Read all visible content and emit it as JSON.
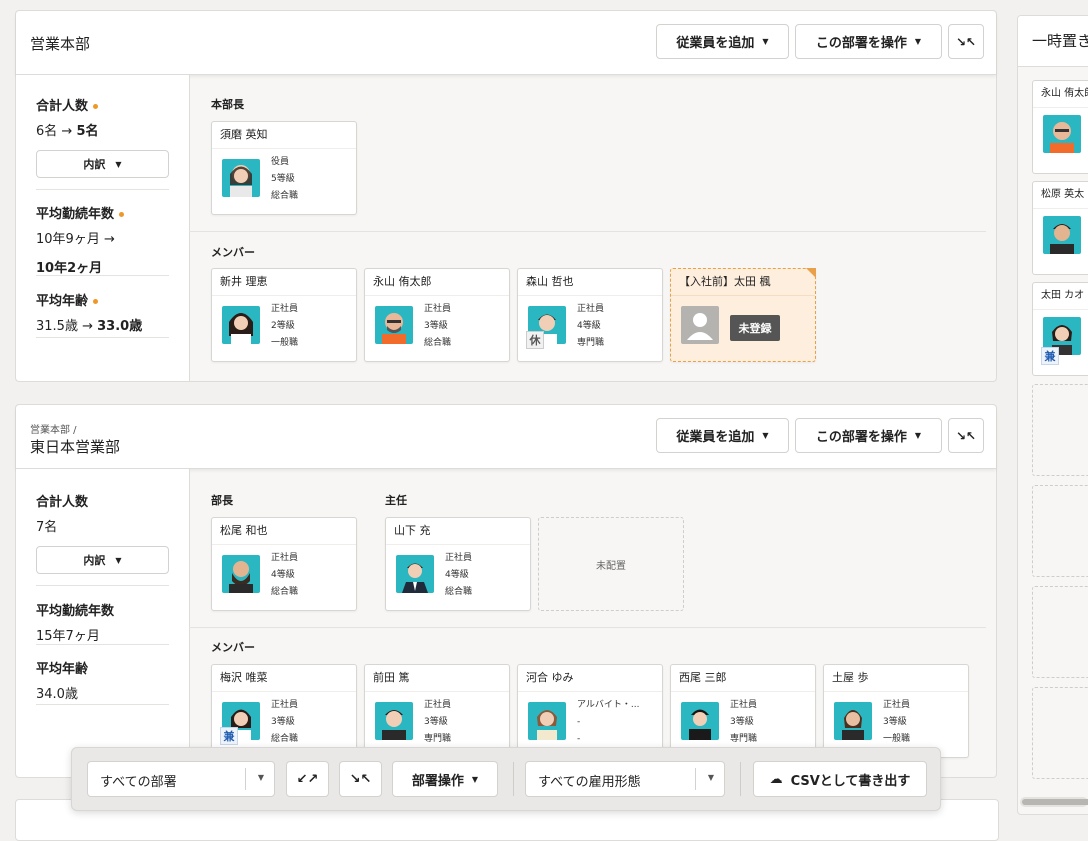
{
  "colors": {
    "accent_dot": "#f0972a",
    "pending_card_bg": "#fdeedd",
    "pending_card_border": "#e8a04a"
  },
  "actions": {
    "add_employee": "従業員を追加",
    "operate_dept": "この部署を操作"
  },
  "dept1": {
    "title": "営業本部",
    "stats": {
      "total_label": "合計人数",
      "total_from": "6名",
      "total_to": "5名",
      "breakdown": "内訳",
      "tenure_label": "平均勤続年数",
      "tenure_from": "10年9ヶ月",
      "tenure_to": "10年2ヶ月",
      "age_label": "平均年齢",
      "age_from": "31.5歳",
      "age_to": "33.0歳"
    },
    "head_label": "本部長",
    "head": {
      "name": "須磨 英知",
      "l1": "役員",
      "l2": "5等級",
      "l3": "総合職"
    },
    "members_label": "メンバー",
    "members": [
      {
        "name": "新井 理恵",
        "l1": "正社員",
        "l2": "2等級",
        "l3": "一般職"
      },
      {
        "name": "永山 侑太郎",
        "l1": "正社員",
        "l2": "3等級",
        "l3": "総合職"
      },
      {
        "name": "森山 哲也",
        "l1": "正社員",
        "l2": "4等級",
        "l3": "専門職",
        "tag": "休"
      },
      {
        "name": "【入社前】太田 楓",
        "unregistered": "未登録"
      }
    ]
  },
  "dept2": {
    "crumb": "営業本部 /",
    "title": "東日本営業部",
    "stats": {
      "total_label": "合計人数",
      "total": "7名",
      "breakdown": "内訳",
      "tenure_label": "平均勤続年数",
      "tenure": "15年7ヶ月",
      "age_label": "平均年齢",
      "age": "34.0歳"
    },
    "role1_label": "部長",
    "role1": {
      "name": "松尾 和也",
      "l1": "正社員",
      "l2": "4等級",
      "l3": "総合職"
    },
    "role2_label": "主任",
    "role2": {
      "name": "山下 充",
      "l1": "正社員",
      "l2": "4等級",
      "l3": "総合職"
    },
    "unassigned": "未配置",
    "members_label": "メンバー",
    "members": [
      {
        "name": "梅沢 唯菜",
        "l1": "正社員",
        "l2": "3等級",
        "l3": "総合職",
        "tag": "兼"
      },
      {
        "name": "前田 篤",
        "l1": "正社員",
        "l2": "3等級",
        "l3": "専門職"
      },
      {
        "name": "河合 ゆみ",
        "l1": "アルバイト・...",
        "l2": "-",
        "l3": "-"
      },
      {
        "name": "西尾 三郎",
        "l1": "正社員",
        "l2": "3等級",
        "l3": "専門職"
      },
      {
        "name": "土屋 歩",
        "l1": "正社員",
        "l2": "3等級",
        "l3": "一般職"
      }
    ]
  },
  "side": {
    "title": "一時置き",
    "cards": [
      {
        "name": "永山 侑太郎"
      },
      {
        "name": "松原 英太"
      },
      {
        "name": "太田 カオ",
        "tag": "兼"
      }
    ]
  },
  "toolbar": {
    "dept_select": "すべての部署",
    "dept_ops": "部署操作",
    "type_select": "すべての雇用形態",
    "csv": "CSVとして書き出す"
  }
}
